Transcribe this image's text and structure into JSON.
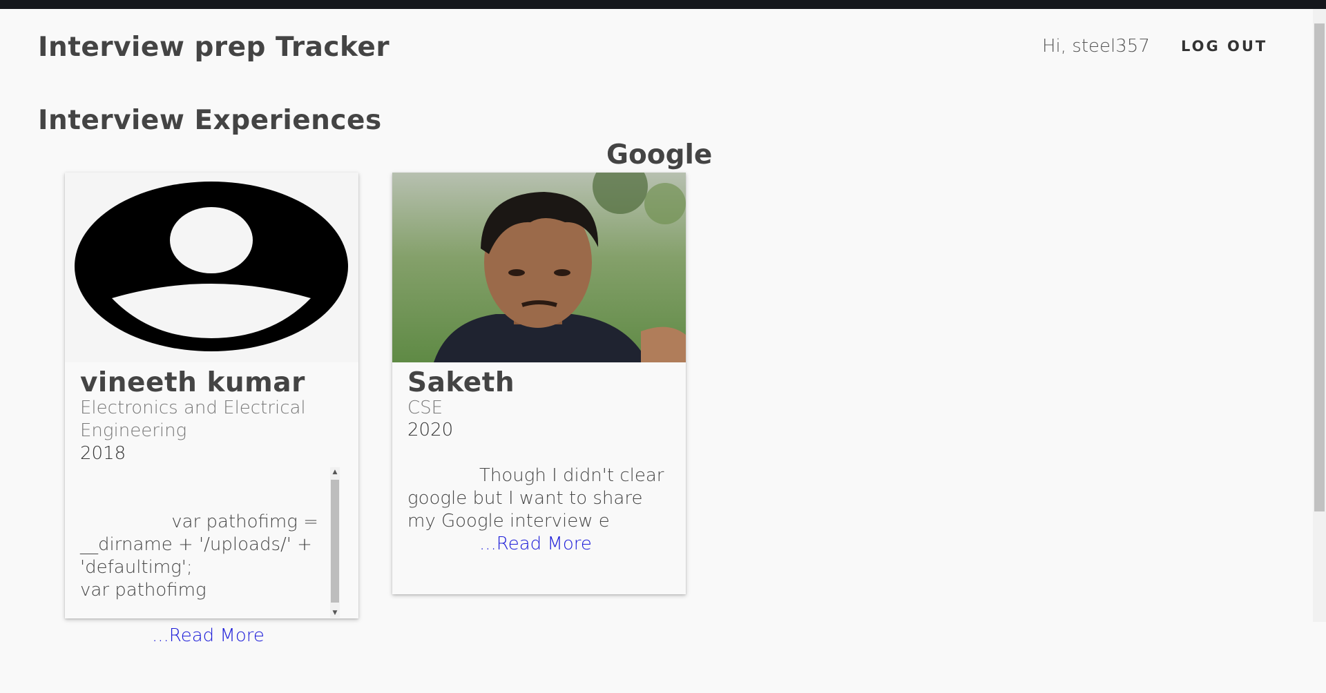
{
  "header": {
    "app_title": "Interview prep Tracker",
    "greeting": "Hi, steel357",
    "logout_label": "LOG OUT"
  },
  "main": {
    "section_title": "Interview Experiences",
    "company": "Google",
    "cards": [
      {
        "name": "vineeth kumar",
        "department": "Electronics and Electrical Engineering",
        "year": "2018",
        "excerpt": "            var pathofimg =\n__dirname + '/uploads/' +\n'defaultimg';\nvar pathofimg",
        "read_more": "...Read More",
        "image_icon": "user-avatar-icon"
      },
      {
        "name": "Saketh",
        "department": "CSE",
        "year": "2020",
        "excerpt": "            Though I didn't clear google but I want to share my Google interview e",
        "read_more": "...Read More",
        "image_icon": "profile-photo"
      }
    ]
  },
  "colors": {
    "background": "#f9f9f9",
    "link": "#1a1ad8",
    "top_strip": "#15171c"
  }
}
